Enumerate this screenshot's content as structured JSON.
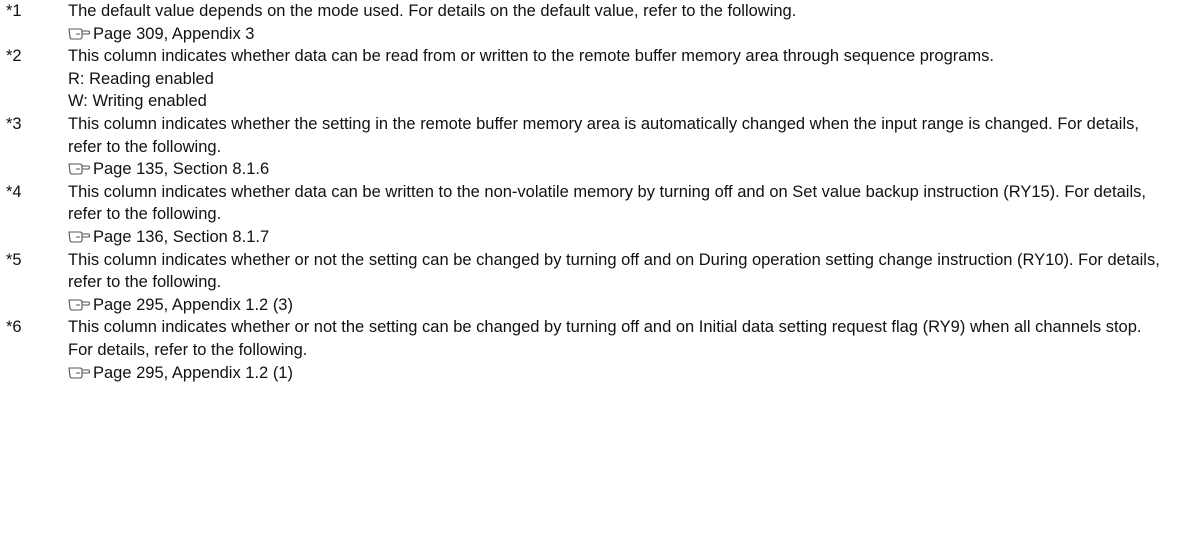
{
  "notes": [
    {
      "mark": "*1",
      "text": "The default value depends on the mode used. For details on the default value, refer to the following.",
      "ref": "Page 309, Appendix 3",
      "extra": []
    },
    {
      "mark": "*2",
      "text": "This column indicates whether data can be read from or written to the remote buffer memory area through sequence programs.",
      "ref": "",
      "extra": [
        "R: Reading enabled",
        "W: Writing enabled"
      ]
    },
    {
      "mark": "*3",
      "text": "This column indicates whether the setting in the remote buffer memory area is automatically changed when the input range is changed. For details, refer to the following.",
      "ref": "Page 135, Section 8.1.6",
      "extra": []
    },
    {
      "mark": "*4",
      "text": "This column indicates whether data can be written to the non-volatile memory by turning off and on Set value backup instruction (RY15). For details, refer to the following.",
      "ref": "Page 136, Section 8.1.7",
      "extra": []
    },
    {
      "mark": "*5",
      "text": "This column indicates whether or not the setting can be changed by turning off and on During operation setting change instruction (RY10). For details, refer to the following.",
      "ref": "Page 295, Appendix 1.2 (3)",
      "extra": []
    },
    {
      "mark": "*6",
      "text": "This column indicates whether or not the setting can be changed by turning off and on Initial data setting request flag (RY9) when all channels stop. For details, refer to the following.",
      "ref": "Page 295, Appendix 1.2 (1)",
      "extra": []
    }
  ],
  "icon": "pointing-hand-reference-icon"
}
